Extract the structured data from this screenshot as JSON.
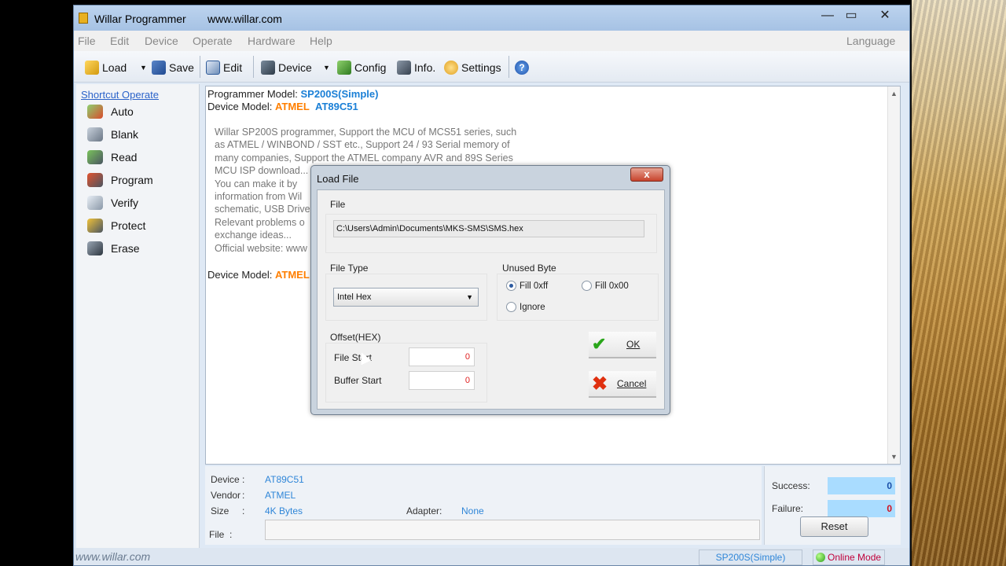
{
  "window": {
    "title": "Willar Programmer",
    "url": "www.willar.com",
    "controls": [
      "—",
      "▭",
      "✕"
    ]
  },
  "menu": [
    "File",
    "Edit",
    "Device",
    "Operate",
    "Hardware",
    "Help",
    "Language"
  ],
  "toolbar": {
    "load": "Load",
    "save": "Save",
    "edit": "Edit",
    "device": "Device",
    "config": "Config",
    "info": "Info.",
    "settings": "Settings"
  },
  "shortcut": {
    "header": "Shortcut Operate",
    "items": [
      "Auto",
      "Blank",
      "Read",
      "Program",
      "Verify",
      "Protect",
      "Erase"
    ]
  },
  "content": {
    "programmer_label": "Programmer Model: ",
    "programmer_value": "SP200S(Simple)",
    "device_label": "Device Model: ",
    "device_vendor": "ATMEL",
    "device_model": "AT89C51",
    "desc": [
      "Willar SP200S programmer, Support the MCU of MCS51 series, such",
      "as ATMEL / WINBOND / SST etc., Support 24 / 93 Serial memory of",
      "many companies, Support the ATMEL company AVR and 89S Series",
      "MCU ISP download...",
      "You can make it by",
      "information from Wil",
      "schematic, USB Drive",
      "Relevant problems o",
      "exchange ideas...",
      "Official website: www"
    ],
    "device_label2": "Device Model: ",
    "device_vendor2": "ATMEL"
  },
  "info": {
    "device_label": "Device",
    "device_value": "AT89C51",
    "vendor_label": "Vendor",
    "vendor_value": "ATMEL",
    "size_label": "Size",
    "size_value": "4K Bytes",
    "adapter_label": "Adapter:",
    "adapter_value": "None",
    "file_label": "File"
  },
  "stats": {
    "success_label": "Success:",
    "success_value": "0",
    "failure_label": "Failure:",
    "failure_value": "0",
    "reset": "Reset"
  },
  "status": {
    "watermark": "www.willar.com",
    "model": "SP200S(Simple)",
    "mode": "Online Mode"
  },
  "dialog": {
    "title": "Load File",
    "close": "x",
    "file_group": "File",
    "path": "C:\\Users\\Admin\\Documents\\MKS-SMS\\SMS.hex",
    "file_type_group": "File Type",
    "file_type_value": "Intel Hex",
    "unused_group": "Unused Byte",
    "fill_ff": "Fill 0xff",
    "fill_00": "Fill 0x00",
    "ignore": "Ignore",
    "offset_group": "Offset(HEX)",
    "file_start_label": "File Start",
    "file_start_value": "0",
    "buffer_start_label": "Buffer Start",
    "buffer_start_value": "0",
    "ok": "OK",
    "cancel": "Cancel"
  },
  "colors": {
    "accent_blue": "#1a7fd6",
    "vendor_orange": "#ff7f00",
    "stat_bar": "#a9dcff",
    "online_red": "#c0003a"
  }
}
